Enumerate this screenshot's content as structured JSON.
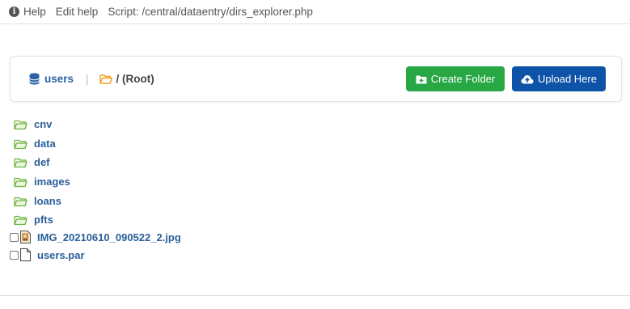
{
  "topbar": {
    "help": "Help",
    "edit_help": "Edit help",
    "script": "Script: /central/dataentry/dirs_explorer.php"
  },
  "breadcrumb": {
    "db": "users",
    "root": "/ (Root)"
  },
  "buttons": {
    "create_folder": "Create Folder",
    "upload_here": "Upload Here"
  },
  "folders": [
    "cnv",
    "data",
    "def",
    "images",
    "loans",
    "pfts"
  ],
  "files": [
    "IMG_20210610_090522_2.jpg",
    "users.par"
  ],
  "colors": {
    "create": "#28a745",
    "upload": "#0d53a8",
    "folder": "#7bc043",
    "link": "#2b5f99"
  }
}
